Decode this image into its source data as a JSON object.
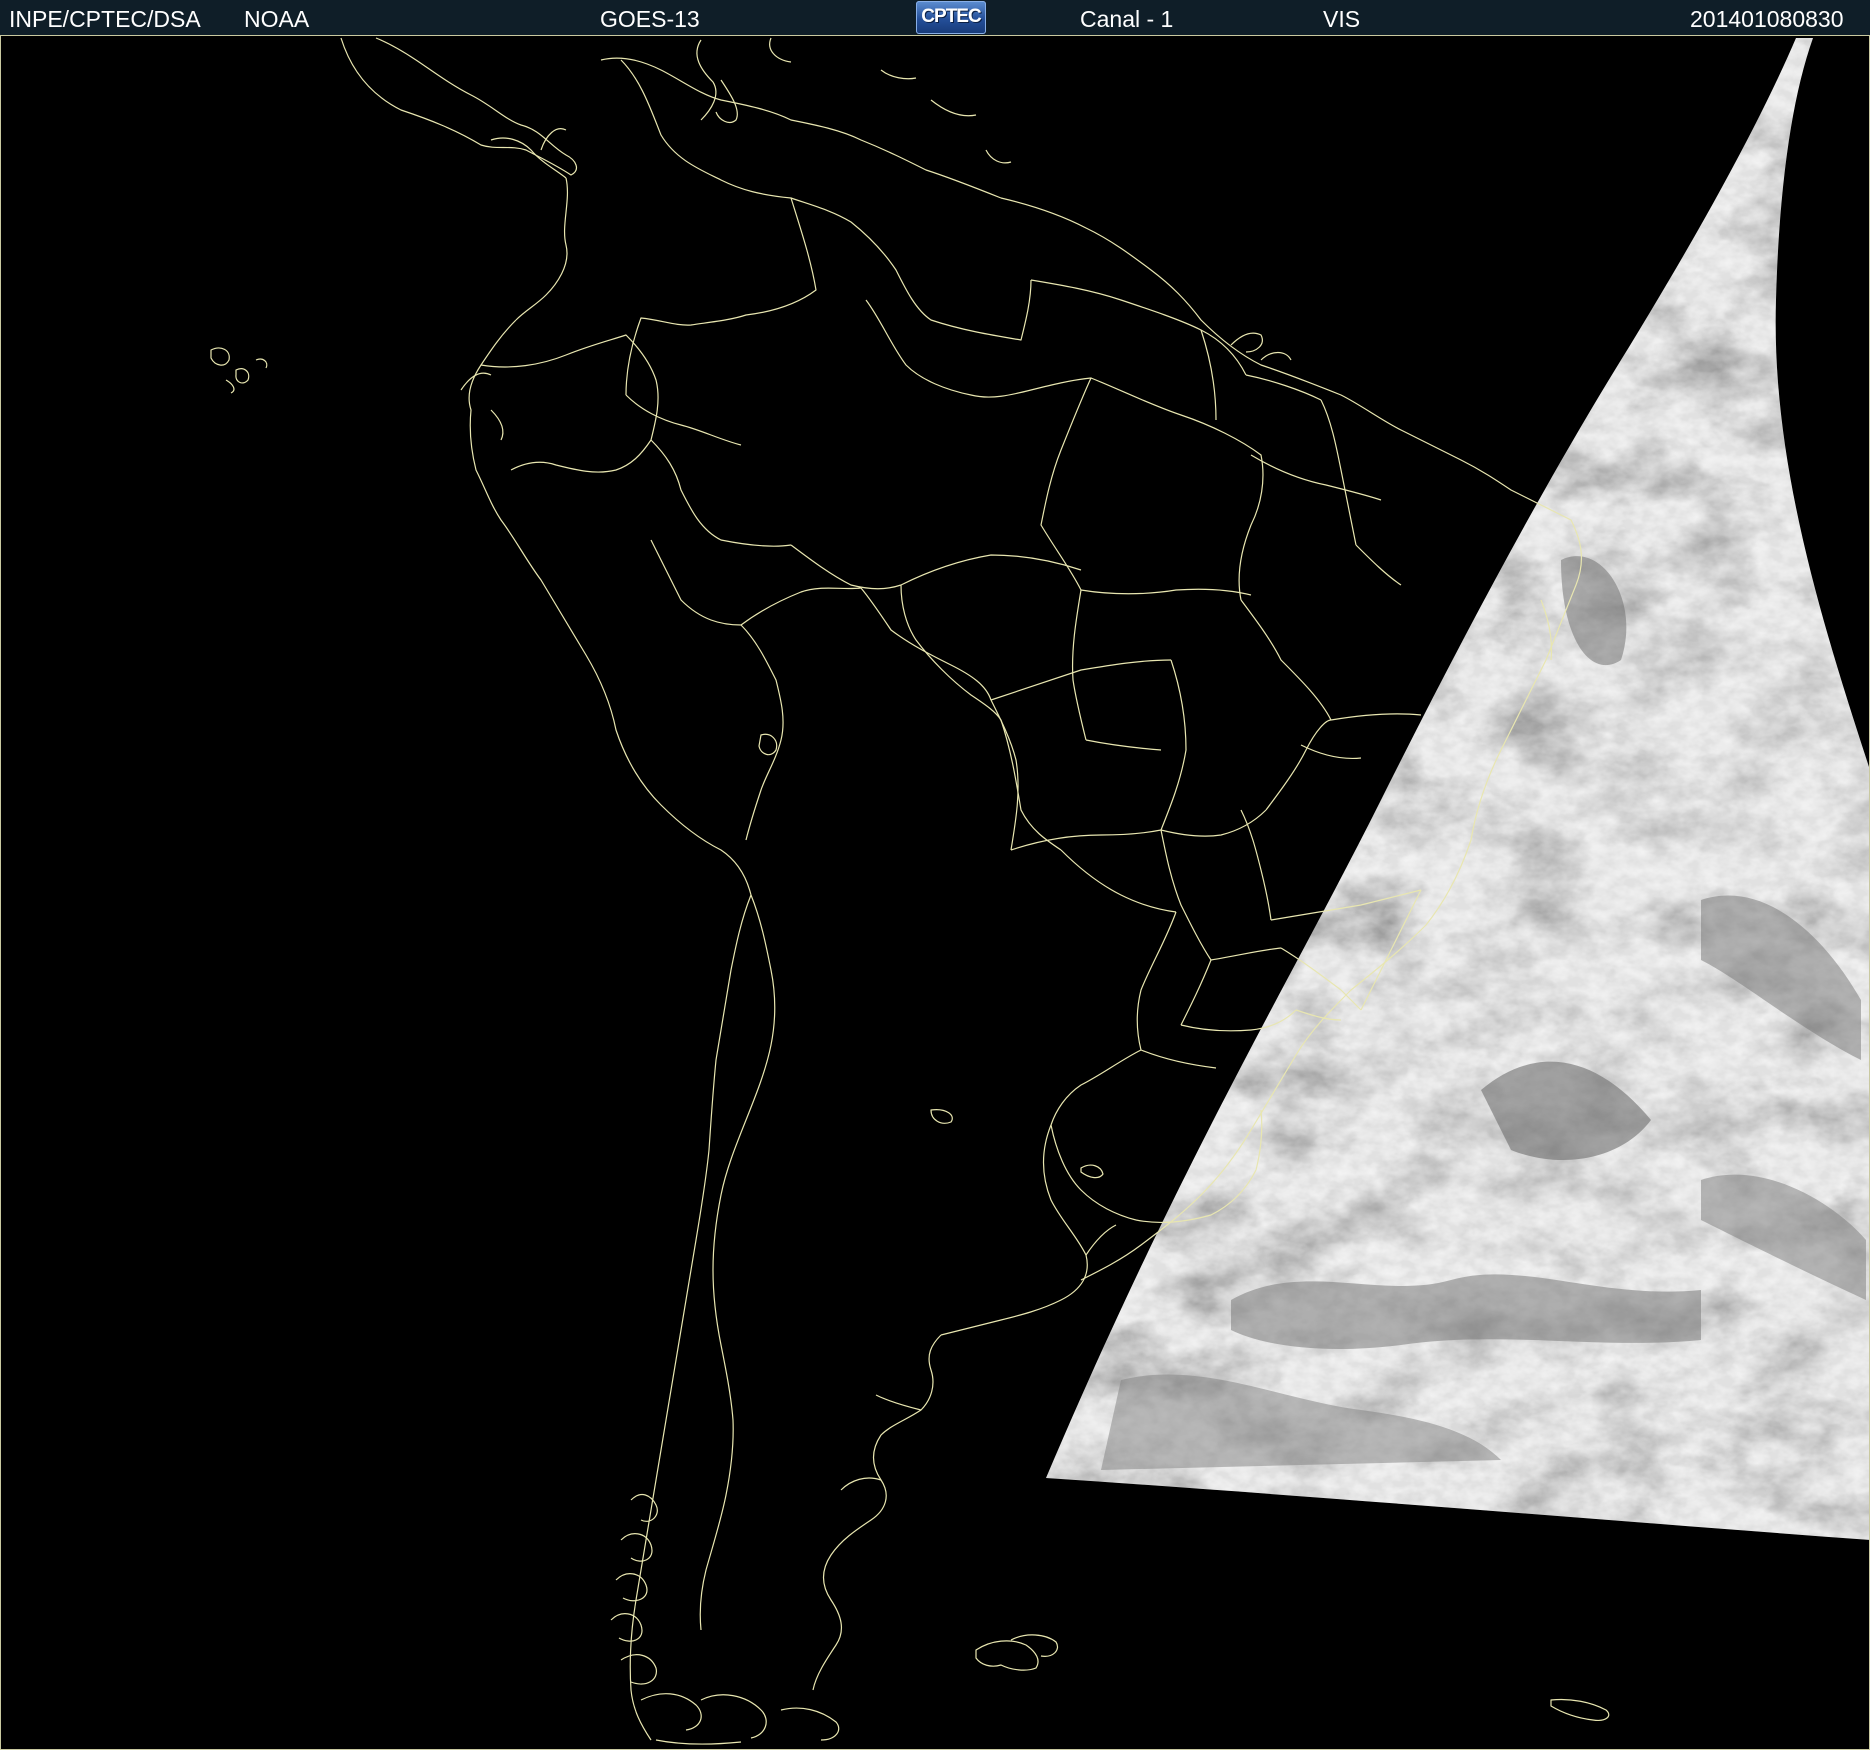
{
  "header": {
    "institution": "INPE/CPTEC/DSA",
    "agency": "NOAA",
    "satellite": "GOES-13",
    "logo_text": "CPTEC",
    "channel": "Canal - 1",
    "band": "VIS",
    "timestamp": "201401080830"
  },
  "colors": {
    "header_bg": "#0f1e28",
    "background": "#000000",
    "coastline": "#e8e6b0",
    "cloud_light": "#f2f2f2",
    "cloud_dark": "#6a6a6a"
  },
  "map": {
    "projection": "satellite",
    "region": "South America",
    "layers": [
      "country-borders",
      "state-borders",
      "visible-imagery"
    ],
    "icons": [
      "cptec-logo"
    ]
  }
}
